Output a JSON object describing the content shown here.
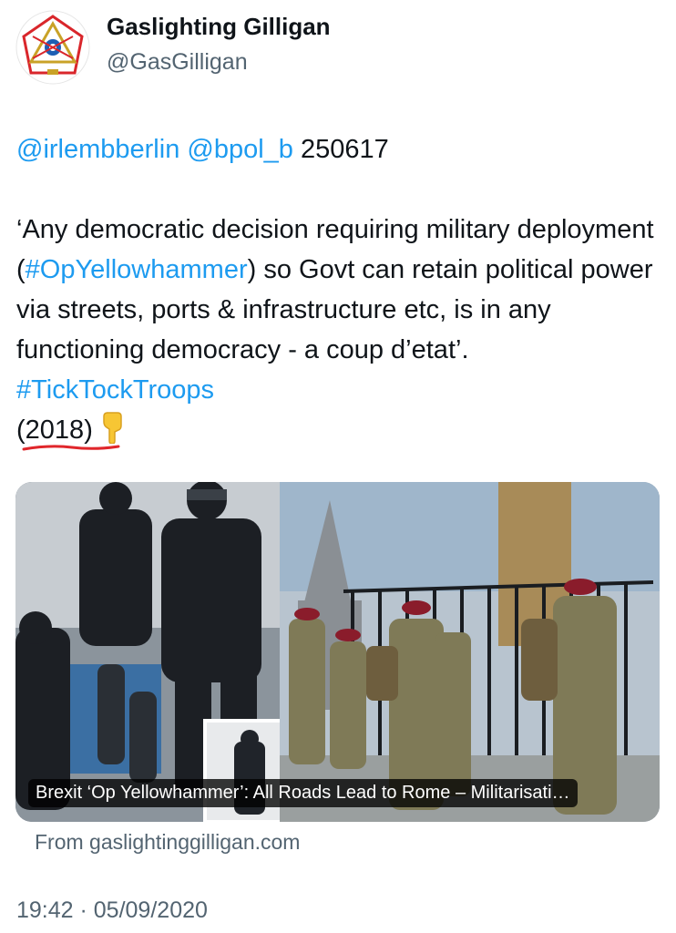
{
  "author": {
    "display_name": "Gaslighting Gilligan",
    "handle": "@GasGilligan",
    "avatar_icon": "masonic-emblem-icon"
  },
  "tweet": {
    "mention_1": "@irlembberlin",
    "mention_2": "@bpol_b",
    "ref_number": "250617",
    "quote_open": "‘Any democratic decision requiring military deployment (",
    "hashtag_1": "#OpYellowhammer",
    "quote_mid": ") so Govt can retain political power via streets, ports & infrastructure etc, is in any functioning democracy - a coup d’etat’.",
    "hashtag_2": "#TickTockTroops",
    "paren_open": "(",
    "year": "2018",
    "paren_close": ")",
    "emoji_icon": "backhand-index-pointing-down-icon"
  },
  "link_card": {
    "caption": "Brexit ‘Op Yellowhammer’: All Roads Lead to Rome – Militarisati…",
    "source": "From gaslightinggilligan.com"
  },
  "timestamp": "19:42 · 05/09/2020",
  "colors": {
    "link": "#1d9bf0",
    "text": "#0f1419",
    "secondary": "#536471",
    "annotation_underline": "#e0262b",
    "beret": "#8a1c2b",
    "camo": "#7f7a57"
  }
}
